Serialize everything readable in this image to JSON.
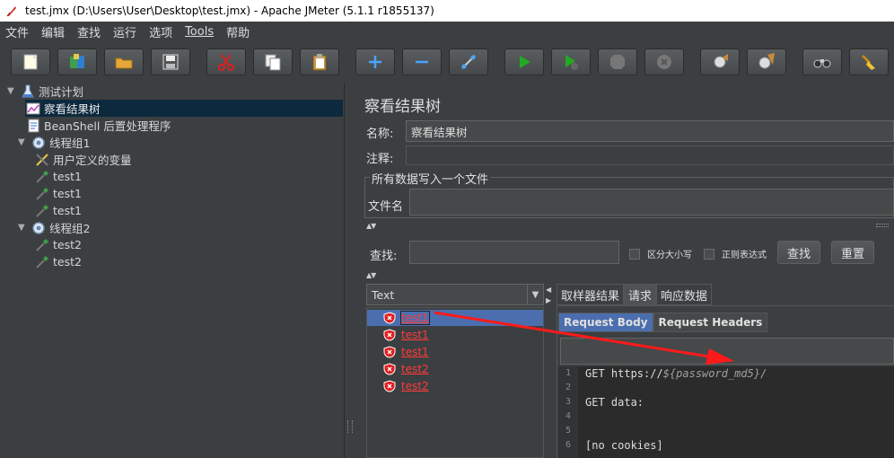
{
  "window": {
    "title": "test.jmx (D:\\Users\\User\\Desktop\\test.jmx) - Apache JMeter (5.1.1 r1855137)"
  },
  "menu": {
    "items": [
      "文件",
      "编辑",
      "查找",
      "运行",
      "选项",
      "Tools",
      "帮助"
    ]
  },
  "toolbar": {
    "buttons": [
      {
        "icon": "new-icon"
      },
      {
        "icon": "templates-icon"
      },
      {
        "icon": "open-icon"
      },
      {
        "icon": "save-icon"
      },
      {
        "icon": "cut-icon"
      },
      {
        "icon": "copy-icon"
      },
      {
        "icon": "paste-icon"
      },
      {
        "icon": "expand-icon"
      },
      {
        "icon": "collapse-icon"
      },
      {
        "icon": "toggle-icon"
      },
      {
        "icon": "start-icon"
      },
      {
        "icon": "start-no-pause-icon"
      },
      {
        "icon": "stop-icon"
      },
      {
        "icon": "shutdown-icon"
      },
      {
        "icon": "clear-icon"
      },
      {
        "icon": "clear-all-icon"
      },
      {
        "icon": "search-icon"
      },
      {
        "icon": "reset-search-icon"
      }
    ]
  },
  "tree": {
    "items": [
      {
        "label": "测试计划",
        "icon": "flask-icon"
      },
      {
        "label": "察看结果树",
        "icon": "graph-icon"
      },
      {
        "label": "BeanShell 后置处理程序",
        "icon": "document-icon"
      },
      {
        "label": "线程组1",
        "icon": "gear-icon"
      },
      {
        "label": "用户定义的变量",
        "icon": "tools-icon"
      },
      {
        "label": "test1",
        "icon": "pipette-icon"
      },
      {
        "label": "test1",
        "icon": "pipette-icon"
      },
      {
        "label": "test1",
        "icon": "pipette-icon"
      },
      {
        "label": "线程组2",
        "icon": "gear-icon"
      },
      {
        "label": "test2",
        "icon": "pipette-icon"
      },
      {
        "label": "test2",
        "icon": "pipette-icon"
      }
    ]
  },
  "panel": {
    "title": "察看结果树",
    "name_label": "名称:",
    "name_value": "察看结果树",
    "comment_label": "注释:",
    "comment_value": "",
    "file_section": "所有数据写入一个文件",
    "file_label": "文件名",
    "file_value": "",
    "search_label": "查找:",
    "search_value": "",
    "case_sensitive": "区分大小写",
    "regex": "正则表达式",
    "find_button": "查找",
    "reset_button": "重置"
  },
  "results": {
    "renderer": "Text",
    "items": [
      "test1",
      "test1",
      "test1",
      "test2",
      "test2"
    ],
    "status_color": "#ff3b3b"
  },
  "detail": {
    "tabs": [
      "取样器结果",
      "请求",
      "响应数据"
    ],
    "active_tab": "请求",
    "subtabs": [
      "Request Body",
      "Request Headers"
    ],
    "active_subtab": "Request Body",
    "lines": [
      {
        "num": "1",
        "prefix": "GET https://",
        "italic": "${password_md5}/"
      },
      {
        "num": "2",
        "prefix": "",
        "italic": ""
      },
      {
        "num": "3",
        "prefix": "GET data:",
        "italic": ""
      },
      {
        "num": "4",
        "prefix": "",
        "italic": ""
      },
      {
        "num": "5",
        "prefix": "",
        "italic": ""
      },
      {
        "num": "6",
        "prefix": "[no cookies]",
        "italic": ""
      }
    ]
  },
  "annotation": {
    "arrow_color": "#ff1a1a"
  }
}
